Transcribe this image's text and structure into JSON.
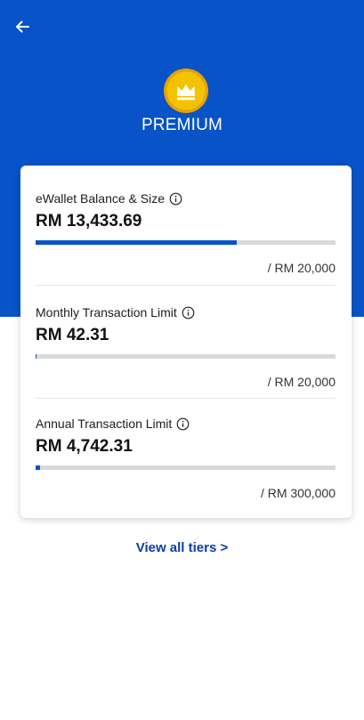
{
  "header": {
    "tier_name": "PREMIUM"
  },
  "limits": [
    {
      "title": "eWallet Balance & Size",
      "value": "RM 13,433.69",
      "max": "/ RM 20,000",
      "progress_fraction": 0.672
    },
    {
      "title": "Monthly Transaction Limit",
      "value": "RM 42.31",
      "max": "/ RM 20,000",
      "progress_fraction": 0.002
    },
    {
      "title": "Annual Transaction Limit",
      "value": "RM 4,742.31",
      "max": "/ RM 300,000",
      "progress_fraction": 0.016
    }
  ],
  "footer": {
    "view_all_label": "View all tiers >"
  },
  "colors": {
    "brand_blue": "#0753c7",
    "badge_gold": "#f3c300",
    "link_blue": "#0f3aa8"
  },
  "icons": {
    "back": "arrow-left-icon",
    "badge": "crown-icon",
    "info": "info-icon"
  }
}
